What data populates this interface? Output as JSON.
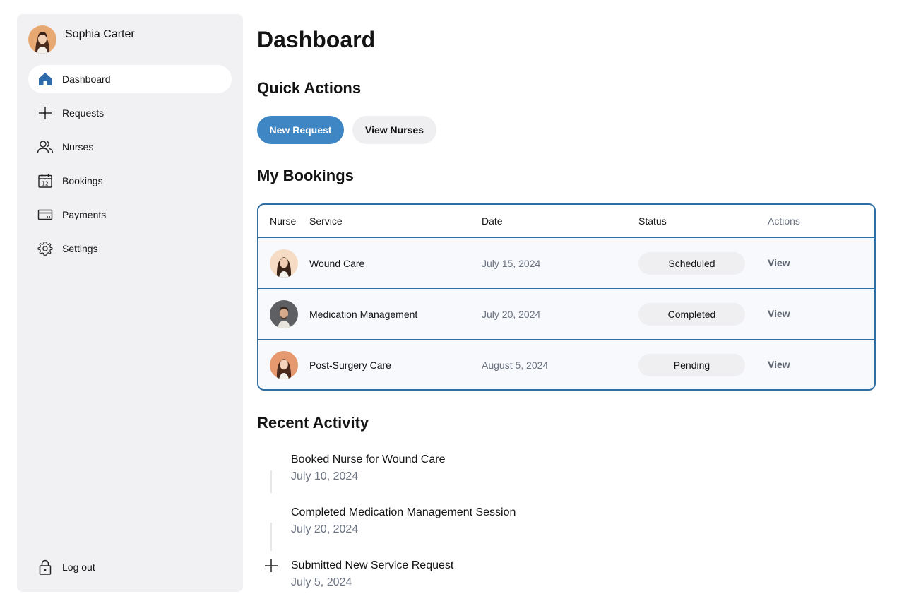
{
  "user": {
    "name": "Sophia Carter"
  },
  "sidebar": {
    "items": [
      {
        "label": "Dashboard",
        "icon": "home-icon",
        "active": true
      },
      {
        "label": "Requests",
        "icon": "plus-icon",
        "active": false
      },
      {
        "label": "Nurses",
        "icon": "users-icon",
        "active": false
      },
      {
        "label": "Bookings",
        "icon": "calendar-icon",
        "active": false
      },
      {
        "label": "Payments",
        "icon": "credit-card-icon",
        "active": false
      },
      {
        "label": "Settings",
        "icon": "gear-icon",
        "active": false
      }
    ],
    "logout": {
      "label": "Log out",
      "icon": "lock-icon"
    }
  },
  "page": {
    "title": "Dashboard"
  },
  "quick_actions": {
    "title": "Quick Actions",
    "primary_label": "New Request",
    "secondary_label": "View Nurses"
  },
  "bookings": {
    "title": "My Bookings",
    "columns": {
      "nurse": "Nurse",
      "service": "Service",
      "date": "Date",
      "status": "Status",
      "actions": "Actions"
    },
    "rows": [
      {
        "service": "Wound Care",
        "date": "July 15, 2024",
        "status": "Scheduled",
        "action": "View"
      },
      {
        "service": "Medication Management",
        "date": "July 20, 2024",
        "status": "Completed",
        "action": "View"
      },
      {
        "service": "Post-Surgery Care",
        "date": "August 5, 2024",
        "status": "Pending",
        "action": "View"
      }
    ]
  },
  "activity": {
    "title": "Recent Activity",
    "items": [
      {
        "title": "Booked Nurse for Wound Care",
        "date": "July 10, 2024"
      },
      {
        "title": "Completed Medication Management Session",
        "date": "July 20, 2024"
      },
      {
        "title": "Submitted New Service Request",
        "date": "July 5, 2024"
      }
    ]
  },
  "colors": {
    "accent": "#3f86c4",
    "table_border": "#2f6ea3",
    "sidebar_bg": "#f1f1f4",
    "badge_bg": "#efeff2"
  }
}
